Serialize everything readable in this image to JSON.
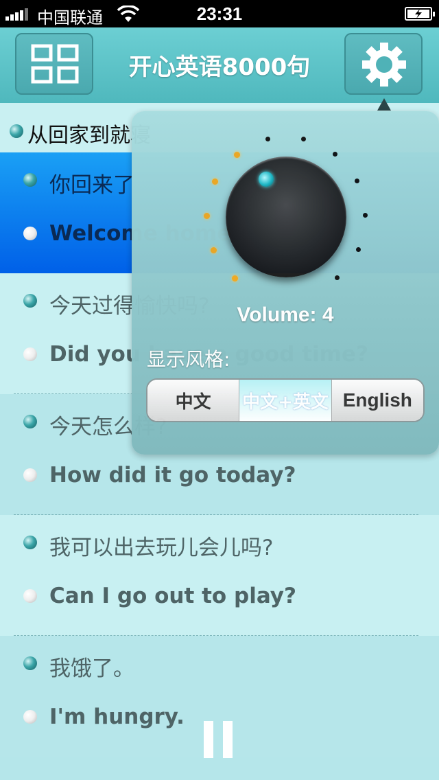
{
  "status_bar": {
    "carrier": "中国联通",
    "time": "23:31"
  },
  "nav": {
    "title": "开心英语8000句",
    "menu_icon": "grid-icon",
    "settings_icon": "gear-icon"
  },
  "section": {
    "title": "从回家到就寝"
  },
  "sentences": [
    {
      "cn": "你回来了",
      "en": "Welcome home"
    },
    {
      "cn": "今天过得愉快吗?",
      "en": "Did you have a good time?"
    },
    {
      "cn": "今天怎么样?",
      "en": "How did it go today?"
    },
    {
      "cn": "我可以出去玩儿会儿吗?",
      "en": "Can I go out to play?"
    },
    {
      "cn": "我饿了。",
      "en": "I'm hungry."
    }
  ],
  "popover": {
    "volume_label": "Volume: 4",
    "volume_level": 4,
    "style_label": "显示风格:",
    "style_options": [
      "中文",
      "中文+英文",
      "English"
    ],
    "selected_style": "中文+英文"
  },
  "colors": {
    "nav": "#5cc3c8",
    "selected_row": "#0a78f0",
    "knob_led": "#1fb8c4",
    "volume_tick_on": "#f0a820"
  }
}
